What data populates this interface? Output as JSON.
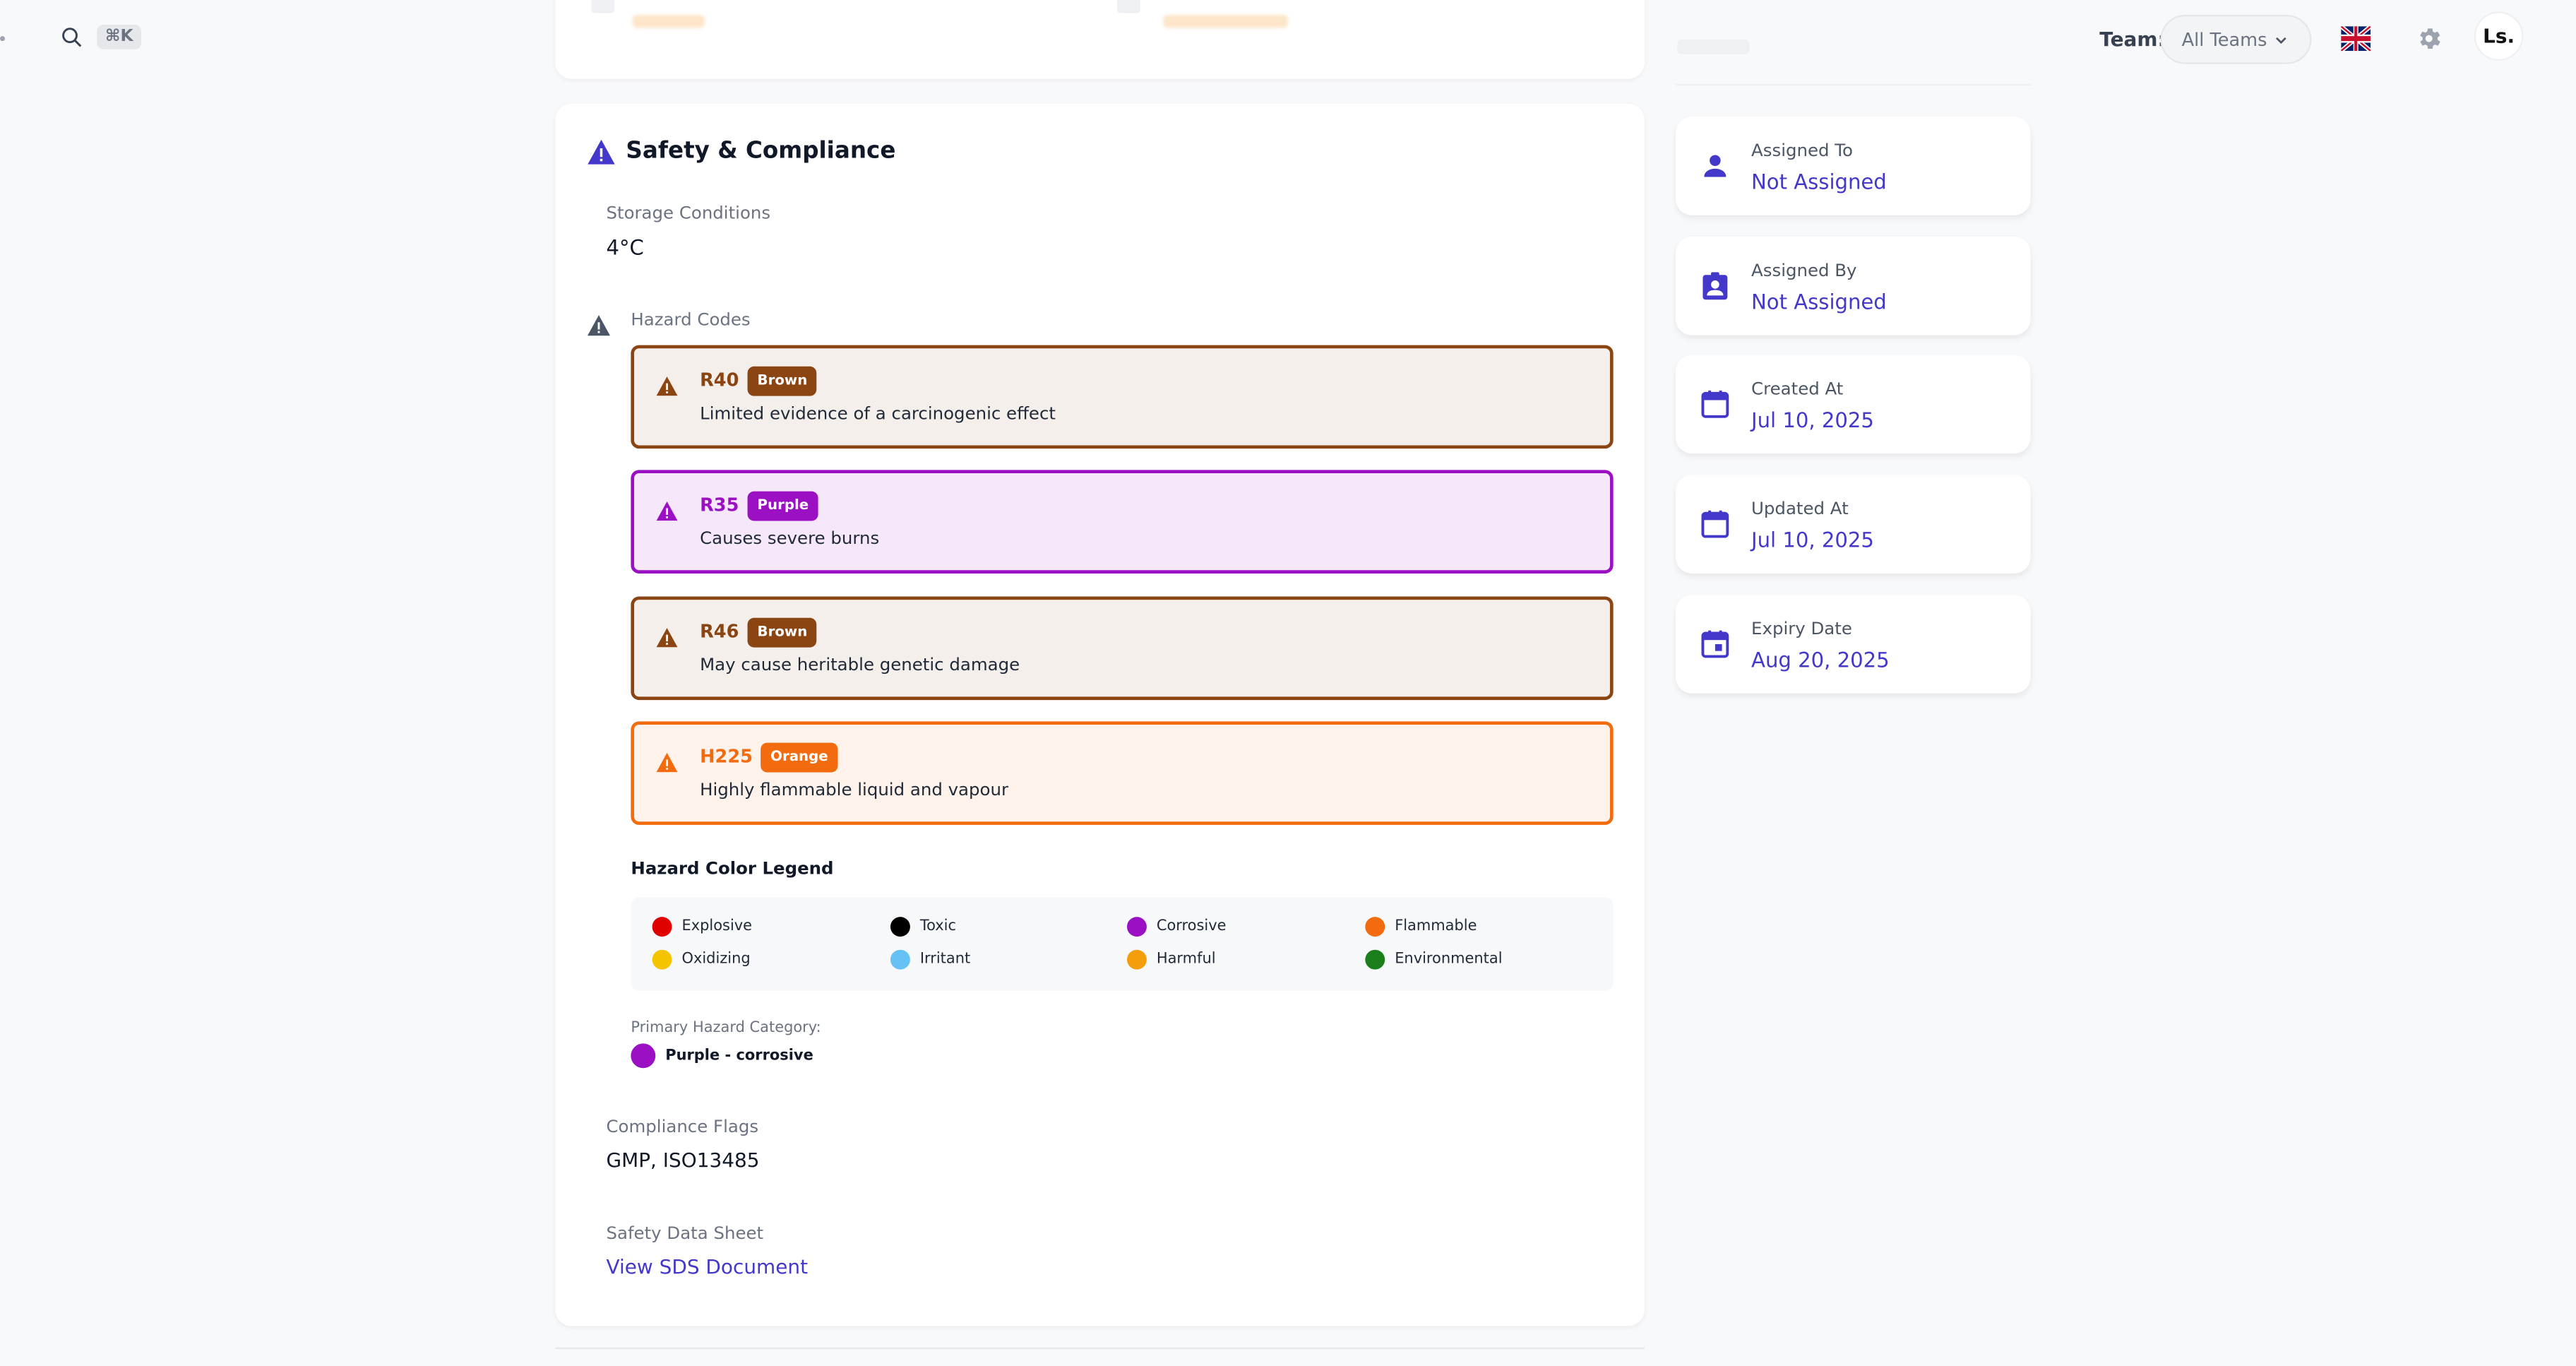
{
  "topbar": {
    "search_shortcut": "⌘K",
    "team_label": "Team:",
    "team_value": "All Teams",
    "avatar_initials": "Ls."
  },
  "safety": {
    "title": "Safety & Compliance",
    "storage_label": "Storage Conditions",
    "storage_value": "4°C",
    "hazard_codes_label": "Hazard Codes",
    "hazards": [
      {
        "code": "R40",
        "badge": "Brown",
        "description": "Limited evidence of a carcinogenic effect",
        "color": "#8b4513",
        "bg": "#f4efeb"
      },
      {
        "code": "R35",
        "badge": "Purple",
        "description": "Causes severe burns",
        "color": "#9c10c4",
        "bg": "#f6e8fa"
      },
      {
        "code": "R46",
        "badge": "Brown",
        "description": "May cause heritable genetic damage",
        "color": "#8b4513",
        "bg": "#f4efeb"
      },
      {
        "code": "H225",
        "badge": "Orange",
        "description": "Highly flammable liquid and vapour",
        "color": "#f26b0f",
        "bg": "#fef2ea"
      }
    ],
    "legend_title": "Hazard Color Legend",
    "legend": [
      {
        "label": "Explosive",
        "color": "#e00000"
      },
      {
        "label": "Toxic",
        "color": "#000000"
      },
      {
        "label": "Corrosive",
        "color": "#9c10c4"
      },
      {
        "label": "Flammable",
        "color": "#f26b0f"
      },
      {
        "label": "Oxidizing",
        "color": "#f5c400"
      },
      {
        "label": "Irritant",
        "color": "#66c2f5"
      },
      {
        "label": "Harmful",
        "color": "#f59e0b"
      },
      {
        "label": "Environmental",
        "color": "#1a7f1a"
      }
    ],
    "primary_label": "Primary Hazard Category:",
    "primary_value": "Purple - corrosive",
    "primary_color": "#9c10c4",
    "compliance_label": "Compliance Flags",
    "compliance_value": "GMP, ISO13485",
    "sds_label": "Safety Data Sheet",
    "sds_link": "View SDS Document"
  },
  "sidebar": {
    "cards": [
      {
        "label": "Assigned To",
        "value": "Not Assigned",
        "icon": "person-icon"
      },
      {
        "label": "Assigned By",
        "value": "Not Assigned",
        "icon": "assignment-ind-icon"
      },
      {
        "label": "Created At",
        "value": "Jul 10, 2025",
        "icon": "calendar-icon"
      },
      {
        "label": "Updated At",
        "value": "Jul 10, 2025",
        "icon": "calendar-icon"
      },
      {
        "label": "Expiry Date",
        "value": "Aug 20, 2025",
        "icon": "event-icon"
      }
    ]
  },
  "colors": {
    "accent": "#4338ca",
    "icon_accent": "#4f46e5"
  }
}
